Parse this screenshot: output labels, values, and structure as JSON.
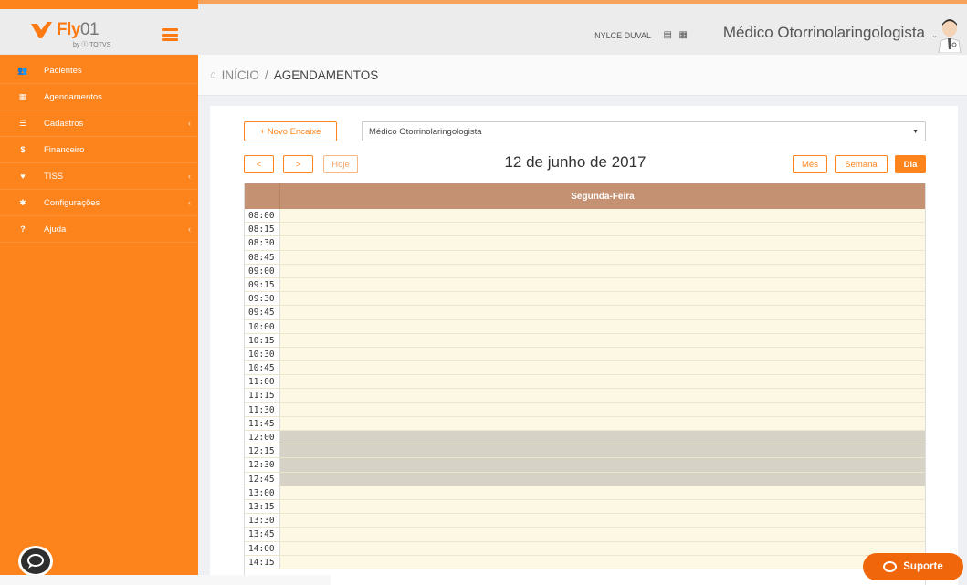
{
  "brand": {
    "name_bold": "Fly",
    "name_light": "01",
    "sub": "by ⓣ TOTVS",
    "color": "#fd841d"
  },
  "sidebar": {
    "items": [
      {
        "icon": "users-icon",
        "glyph": "👥",
        "label": "Pacientes",
        "chevron": false
      },
      {
        "icon": "calendar-icon",
        "glyph": "▦",
        "label": "Agendamentos",
        "chevron": false
      },
      {
        "icon": "list-icon",
        "glyph": "☰",
        "label": "Cadastros",
        "chevron": true
      },
      {
        "icon": "dollar-icon",
        "glyph": "$",
        "label": "Financeiro",
        "chevron": false
      },
      {
        "icon": "handshake-icon",
        "glyph": "♥",
        "label": "TISS",
        "chevron": true
      },
      {
        "icon": "gear-icon",
        "glyph": "✱",
        "label": "Configurações",
        "chevron": true
      },
      {
        "icon": "question-icon",
        "glyph": "?",
        "label": "Ajuda",
        "chevron": true
      }
    ]
  },
  "header": {
    "user_name": "NYLCE DUVAL",
    "profile_title": "Médico Otorrinolaringologista"
  },
  "breadcrumb": {
    "home": "INÍCIO",
    "current": "AGENDAMENTOS"
  },
  "toolbar": {
    "new_button": "+ Novo Encaixe",
    "select_value": "Médico Otorrinolaringologista",
    "prev": "<",
    "next": ">",
    "today": "Hoje",
    "date_title": "12 de junho de 2017",
    "view_month": "Mês",
    "view_week": "Semana",
    "view_day": "Dia"
  },
  "calendar": {
    "day_header": "Segunda-Feira",
    "times": [
      "08:00",
      "08:15",
      "08:30",
      "08:45",
      "09:00",
      "09:15",
      "09:30",
      "09:45",
      "10:00",
      "10:15",
      "10:30",
      "10:45",
      "11:00",
      "11:15",
      "11:30",
      "11:45",
      "12:00",
      "12:15",
      "12:30",
      "12:45",
      "13:00",
      "13:15",
      "13:30",
      "13:45",
      "14:00",
      "14:15"
    ],
    "blocked": [
      "12:00",
      "12:15",
      "12:30",
      "12:45"
    ]
  },
  "support": {
    "label": "Suporte"
  }
}
